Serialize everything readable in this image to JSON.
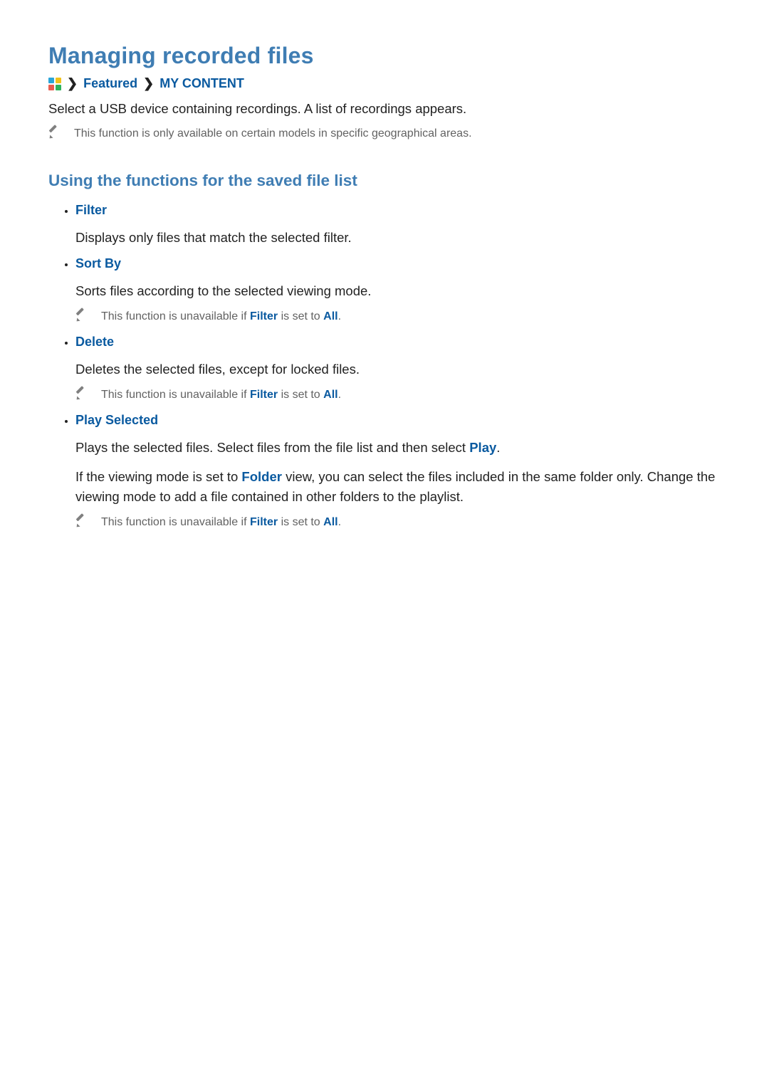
{
  "title": "Managing recorded files",
  "breadcrumb": {
    "featured": "Featured",
    "mycontent": "MY CONTENT"
  },
  "intro": "Select a USB device containing recordings. A list of recordings appears.",
  "top_note": "This function is only available on certain models in specific geographical areas.",
  "section": "Using the functions for the saved file list",
  "items": {
    "filter": {
      "head": "Filter",
      "body": "Displays only files that match the selected filter."
    },
    "sortby": {
      "head": "Sort By",
      "body": "Sorts files according to the selected viewing mode.",
      "note_pre": "This function is unavailable if ",
      "note_kw1": "Filter",
      "note_mid": " is set to ",
      "note_kw2": "All",
      "note_post": "."
    },
    "delete": {
      "head": "Delete",
      "body": "Deletes the selected files, except for locked files.",
      "note_pre": "This function is unavailable if ",
      "note_kw1": "Filter",
      "note_mid": " is set to ",
      "note_kw2": "All",
      "note_post": "."
    },
    "play": {
      "head": "Play Selected",
      "body1_pre": "Plays the selected files. Select files from the file list and then select ",
      "body1_kw": "Play",
      "body1_post": ".",
      "body2_pre": "If the viewing mode is set to ",
      "body2_kw": "Folder",
      "body2_post": " view, you can select the files included in the same folder only. Change the viewing mode to add a file contained in other folders to the playlist.",
      "note_pre": "This function is unavailable if ",
      "note_kw1": "Filter",
      "note_mid": " is set to ",
      "note_kw2": "All",
      "note_post": "."
    }
  }
}
